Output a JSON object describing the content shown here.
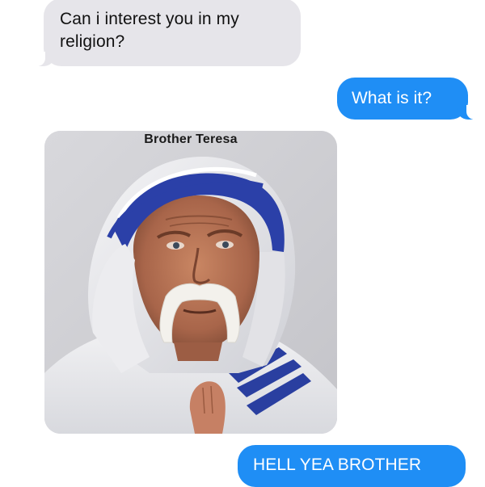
{
  "conversation": {
    "messages": [
      {
        "sender": "other",
        "text": "Can i interest you in my religion?"
      },
      {
        "sender": "me",
        "text": "What is it?"
      },
      {
        "sender": "other",
        "type": "image",
        "caption": "Brother Teresa"
      },
      {
        "sender": "me",
        "text": "HELL YEA BROTHER"
      }
    ]
  },
  "colors": {
    "incoming_bubble": "#e6e5ea",
    "outgoing_bubble": "#1f8ef5",
    "background": "#ffffff"
  }
}
